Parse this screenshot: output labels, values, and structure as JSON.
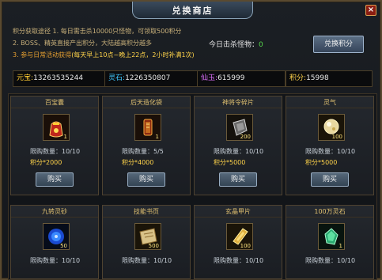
{
  "window": {
    "title": "兑换商店",
    "close_label": "×"
  },
  "info": {
    "line1": "积分获取途径 1. 每日需击杀10000只怪物，可领取500积分",
    "line2": "2. BOSS、精英直接产出积分，大陆越高积分越多",
    "line3_prefix": "3. 参与日常活动获得",
    "line3_highlight": "(每天早上10点~晚上22点，2小时补满1次)"
  },
  "kills": {
    "label": "今日击杀怪物：",
    "value": "0"
  },
  "exchange_button": "兑换积分",
  "currencies": [
    {
      "key": "元宝",
      "value": "13263535244",
      "color": "#ffcc33"
    },
    {
      "key": "灵石",
      "value": "1226350807",
      "color": "#3fc8ff"
    },
    {
      "key": "仙玉",
      "value": "615999",
      "color": "#e070ff"
    },
    {
      "key": "积分",
      "value": "15998",
      "color": "#ffd34a"
    }
  ],
  "items": [
    {
      "name": "百宝囊",
      "count": "1",
      "limit": "限购数量：10/10",
      "price": "积分*2000",
      "buy": "购买",
      "icon": "red-bag-icon"
    },
    {
      "name": "后天造化袋",
      "count": "1",
      "limit": "限购数量：5/5",
      "price": "积分*4000",
      "buy": "购买",
      "icon": "scroll-bag-icon"
    },
    {
      "name": "神将令碎片",
      "count": "200",
      "limit": "限购数量：10/10",
      "price": "积分*5000",
      "buy": "购买",
      "icon": "token-fragment-icon"
    },
    {
      "name": "灵气",
      "count": "100",
      "limit": "限购数量：10/10",
      "price": "积分*5000",
      "buy": "购买",
      "icon": "spirit-energy-icon"
    },
    {
      "name": "九转灵砂",
      "count": "50",
      "limit": "限购数量：10/10",
      "price": "",
      "buy": "",
      "icon": "blue-sand-icon"
    },
    {
      "name": "技能书页",
      "count": "500",
      "limit": "限购数量：10/10",
      "price": "",
      "buy": "",
      "icon": "skill-page-icon"
    },
    {
      "name": "玄晶甲片",
      "count": "100",
      "limit": "限购数量：10/10",
      "price": "",
      "buy": "",
      "icon": "armor-shard-icon"
    },
    {
      "name": "100万灵石",
      "count": "1",
      "limit": "限购数量：10/10",
      "price": "",
      "buy": "",
      "icon": "green-stone-icon"
    }
  ]
}
